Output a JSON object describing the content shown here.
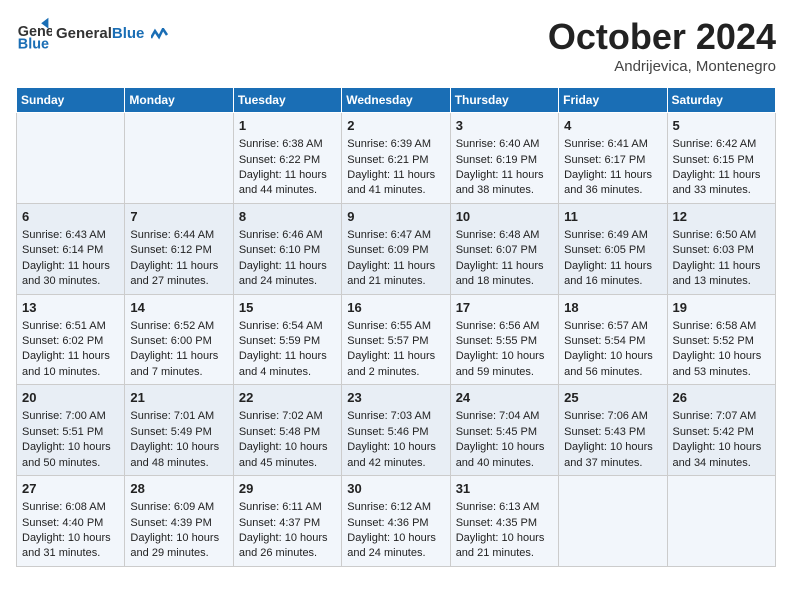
{
  "header": {
    "logo_general": "General",
    "logo_blue": "Blue",
    "month_title": "October 2024",
    "location": "Andrijevica, Montenegro"
  },
  "days_of_week": [
    "Sunday",
    "Monday",
    "Tuesday",
    "Wednesday",
    "Thursday",
    "Friday",
    "Saturday"
  ],
  "weeks": [
    [
      {
        "day": null
      },
      {
        "day": null
      },
      {
        "day": 1,
        "sunrise": "Sunrise: 6:38 AM",
        "sunset": "Sunset: 6:22 PM",
        "daylight": "Daylight: 11 hours and 44 minutes."
      },
      {
        "day": 2,
        "sunrise": "Sunrise: 6:39 AM",
        "sunset": "Sunset: 6:21 PM",
        "daylight": "Daylight: 11 hours and 41 minutes."
      },
      {
        "day": 3,
        "sunrise": "Sunrise: 6:40 AM",
        "sunset": "Sunset: 6:19 PM",
        "daylight": "Daylight: 11 hours and 38 minutes."
      },
      {
        "day": 4,
        "sunrise": "Sunrise: 6:41 AM",
        "sunset": "Sunset: 6:17 PM",
        "daylight": "Daylight: 11 hours and 36 minutes."
      },
      {
        "day": 5,
        "sunrise": "Sunrise: 6:42 AM",
        "sunset": "Sunset: 6:15 PM",
        "daylight": "Daylight: 11 hours and 33 minutes."
      }
    ],
    [
      {
        "day": 6,
        "sunrise": "Sunrise: 6:43 AM",
        "sunset": "Sunset: 6:14 PM",
        "daylight": "Daylight: 11 hours and 30 minutes."
      },
      {
        "day": 7,
        "sunrise": "Sunrise: 6:44 AM",
        "sunset": "Sunset: 6:12 PM",
        "daylight": "Daylight: 11 hours and 27 minutes."
      },
      {
        "day": 8,
        "sunrise": "Sunrise: 6:46 AM",
        "sunset": "Sunset: 6:10 PM",
        "daylight": "Daylight: 11 hours and 24 minutes."
      },
      {
        "day": 9,
        "sunrise": "Sunrise: 6:47 AM",
        "sunset": "Sunset: 6:09 PM",
        "daylight": "Daylight: 11 hours and 21 minutes."
      },
      {
        "day": 10,
        "sunrise": "Sunrise: 6:48 AM",
        "sunset": "Sunset: 6:07 PM",
        "daylight": "Daylight: 11 hours and 18 minutes."
      },
      {
        "day": 11,
        "sunrise": "Sunrise: 6:49 AM",
        "sunset": "Sunset: 6:05 PM",
        "daylight": "Daylight: 11 hours and 16 minutes."
      },
      {
        "day": 12,
        "sunrise": "Sunrise: 6:50 AM",
        "sunset": "Sunset: 6:03 PM",
        "daylight": "Daylight: 11 hours and 13 minutes."
      }
    ],
    [
      {
        "day": 13,
        "sunrise": "Sunrise: 6:51 AM",
        "sunset": "Sunset: 6:02 PM",
        "daylight": "Daylight: 11 hours and 10 minutes."
      },
      {
        "day": 14,
        "sunrise": "Sunrise: 6:52 AM",
        "sunset": "Sunset: 6:00 PM",
        "daylight": "Daylight: 11 hours and 7 minutes."
      },
      {
        "day": 15,
        "sunrise": "Sunrise: 6:54 AM",
        "sunset": "Sunset: 5:59 PM",
        "daylight": "Daylight: 11 hours and 4 minutes."
      },
      {
        "day": 16,
        "sunrise": "Sunrise: 6:55 AM",
        "sunset": "Sunset: 5:57 PM",
        "daylight": "Daylight: 11 hours and 2 minutes."
      },
      {
        "day": 17,
        "sunrise": "Sunrise: 6:56 AM",
        "sunset": "Sunset: 5:55 PM",
        "daylight": "Daylight: 10 hours and 59 minutes."
      },
      {
        "day": 18,
        "sunrise": "Sunrise: 6:57 AM",
        "sunset": "Sunset: 5:54 PM",
        "daylight": "Daylight: 10 hours and 56 minutes."
      },
      {
        "day": 19,
        "sunrise": "Sunrise: 6:58 AM",
        "sunset": "Sunset: 5:52 PM",
        "daylight": "Daylight: 10 hours and 53 minutes."
      }
    ],
    [
      {
        "day": 20,
        "sunrise": "Sunrise: 7:00 AM",
        "sunset": "Sunset: 5:51 PM",
        "daylight": "Daylight: 10 hours and 50 minutes."
      },
      {
        "day": 21,
        "sunrise": "Sunrise: 7:01 AM",
        "sunset": "Sunset: 5:49 PM",
        "daylight": "Daylight: 10 hours and 48 minutes."
      },
      {
        "day": 22,
        "sunrise": "Sunrise: 7:02 AM",
        "sunset": "Sunset: 5:48 PM",
        "daylight": "Daylight: 10 hours and 45 minutes."
      },
      {
        "day": 23,
        "sunrise": "Sunrise: 7:03 AM",
        "sunset": "Sunset: 5:46 PM",
        "daylight": "Daylight: 10 hours and 42 minutes."
      },
      {
        "day": 24,
        "sunrise": "Sunrise: 7:04 AM",
        "sunset": "Sunset: 5:45 PM",
        "daylight": "Daylight: 10 hours and 40 minutes."
      },
      {
        "day": 25,
        "sunrise": "Sunrise: 7:06 AM",
        "sunset": "Sunset: 5:43 PM",
        "daylight": "Daylight: 10 hours and 37 minutes."
      },
      {
        "day": 26,
        "sunrise": "Sunrise: 7:07 AM",
        "sunset": "Sunset: 5:42 PM",
        "daylight": "Daylight: 10 hours and 34 minutes."
      }
    ],
    [
      {
        "day": 27,
        "sunrise": "Sunrise: 6:08 AM",
        "sunset": "Sunset: 4:40 PM",
        "daylight": "Daylight: 10 hours and 31 minutes."
      },
      {
        "day": 28,
        "sunrise": "Sunrise: 6:09 AM",
        "sunset": "Sunset: 4:39 PM",
        "daylight": "Daylight: 10 hours and 29 minutes."
      },
      {
        "day": 29,
        "sunrise": "Sunrise: 6:11 AM",
        "sunset": "Sunset: 4:37 PM",
        "daylight": "Daylight: 10 hours and 26 minutes."
      },
      {
        "day": 30,
        "sunrise": "Sunrise: 6:12 AM",
        "sunset": "Sunset: 4:36 PM",
        "daylight": "Daylight: 10 hours and 24 minutes."
      },
      {
        "day": 31,
        "sunrise": "Sunrise: 6:13 AM",
        "sunset": "Sunset: 4:35 PM",
        "daylight": "Daylight: 10 hours and 21 minutes."
      },
      {
        "day": null
      },
      {
        "day": null
      }
    ]
  ]
}
